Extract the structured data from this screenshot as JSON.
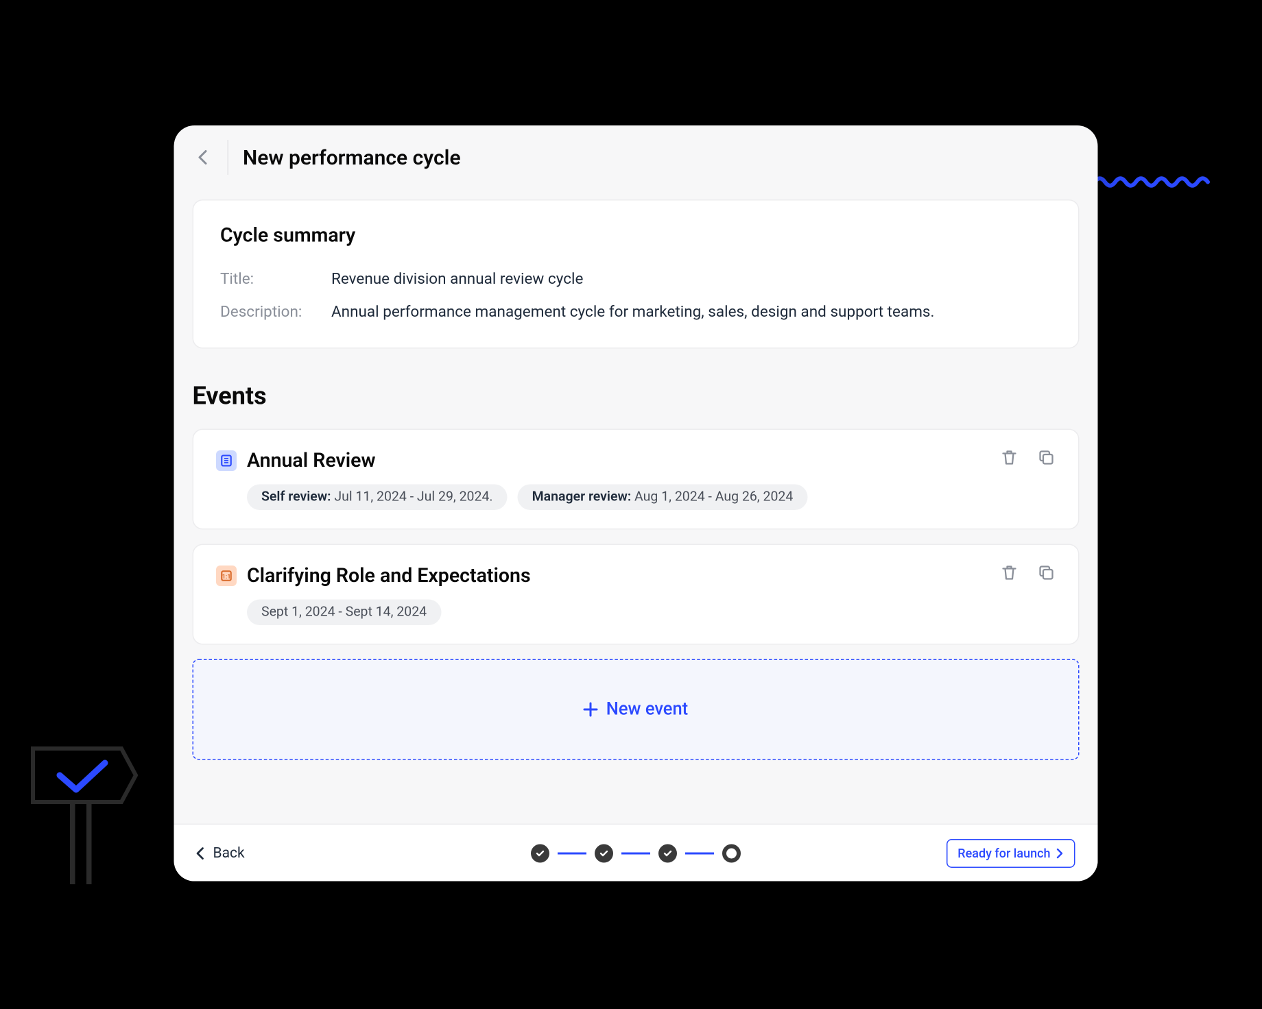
{
  "header": {
    "page_title": "New performance cycle"
  },
  "summary": {
    "heading": "Cycle summary",
    "title_label": "Title:",
    "title_value": "Revenue division annual review cycle",
    "description_label": "Description:",
    "description_value": "Annual performance management cycle for marketing, sales, design and support teams."
  },
  "events": {
    "heading": "Events",
    "items": [
      {
        "title": "Annual Review",
        "icon": "document-icon",
        "icon_color": "blue",
        "pills": [
          {
            "label": "Self review:",
            "value": "Jul 11, 2024 - Jul 29, 2024."
          },
          {
            "label": "Manager review:",
            "value": "Aug 1, 2024 - Aug 26, 2024"
          }
        ]
      },
      {
        "title": "Clarifying Role and Expectations",
        "icon": "one-on-one-icon",
        "icon_color": "orange",
        "pills": [
          {
            "label": "",
            "value": "Sept 1, 2024 - Sept 14, 2024"
          }
        ]
      }
    ],
    "new_event_label": "New event"
  },
  "footer": {
    "back_label": "Back",
    "launch_label": "Ready for launch",
    "steps": [
      "done",
      "done",
      "done",
      "current"
    ]
  },
  "colors": {
    "accent": "#2b49ff"
  }
}
